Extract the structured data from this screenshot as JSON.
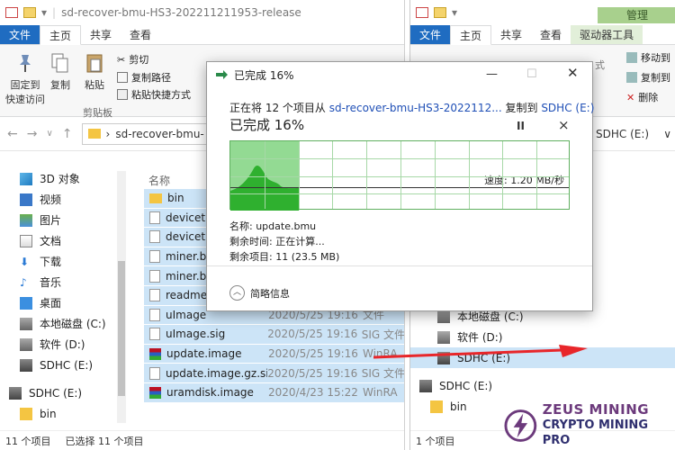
{
  "left_window": {
    "title": "sd-recover-bmu-HS3-202211211953-release",
    "tabs": [
      "文件",
      "主页",
      "共享",
      "查看"
    ],
    "ribbon": {
      "pin": "固定到",
      "pin2": "快速访问",
      "copy": "复制",
      "paste": "粘贴",
      "cut": "剪切",
      "copy_path": "复制路径",
      "paste_shortcut": "粘贴快捷方式",
      "group_clipboard": "剪贴板"
    },
    "address": "sd-recover-bmu-",
    "nav": [
      {
        "label": "3D 对象",
        "icon": "cube-3d-icon"
      },
      {
        "label": "视频",
        "icon": "video-icon"
      },
      {
        "label": "图片",
        "icon": "picture-icon"
      },
      {
        "label": "文档",
        "icon": "document-icon"
      },
      {
        "label": "下载",
        "icon": "download-icon"
      },
      {
        "label": "音乐",
        "icon": "music-icon"
      },
      {
        "label": "桌面",
        "icon": "desktop-icon"
      },
      {
        "label": "本地磁盘 (C:)",
        "icon": "disk-icon"
      },
      {
        "label": "软件 (D:)",
        "icon": "disk-icon"
      },
      {
        "label": "SDHC (E:)",
        "icon": "sd-card-icon"
      },
      {
        "label": "SDHC (E:)",
        "icon": "sd-card-icon"
      },
      {
        "label": "bin",
        "icon": "folder-icon"
      }
    ],
    "column_name": "名称",
    "files": [
      {
        "name": "bin",
        "date": "",
        "type": "",
        "icon": "folder"
      },
      {
        "name": "devicetr",
        "date": "",
        "type": "",
        "icon": "file"
      },
      {
        "name": "devicetr",
        "date": "",
        "type": "",
        "icon": "file"
      },
      {
        "name": "miner.bi",
        "date": "",
        "type": "",
        "icon": "file"
      },
      {
        "name": "miner.bi",
        "date": "",
        "type": "",
        "icon": "file"
      },
      {
        "name": "readme.",
        "date": "",
        "type": "",
        "icon": "file"
      },
      {
        "name": "uImage",
        "date": "2020/5/25 19:16",
        "type": "文件",
        "icon": "file"
      },
      {
        "name": "uImage.sig",
        "date": "2020/5/25 19:16",
        "type": "SIG 文件",
        "icon": "file"
      },
      {
        "name": "update.image",
        "date": "2020/5/25 19:16",
        "type": "WinRA",
        "icon": "rar"
      },
      {
        "name": "update.image.gz.sig",
        "date": "2020/5/25 19:16",
        "type": "SIG 文件",
        "icon": "file"
      },
      {
        "name": "uramdisk.image",
        "date": "2020/4/23 15:22",
        "type": "WinRA",
        "icon": "rar"
      }
    ],
    "status_items": "11 个项目",
    "status_selected": "已选择 11 个项目"
  },
  "right_window": {
    "manage_label": "管理",
    "tabs": [
      "文件",
      "主页",
      "共享",
      "查看",
      "驱动器工具"
    ],
    "ribbon": {
      "move_to": "移动到",
      "copy_to": "复制到",
      "delete": "删除",
      "fmt": "式"
    },
    "address": "SDHC (E:)",
    "nav": [
      {
        "label": "本地磁盘 (C:)",
        "icon": "disk-icon"
      },
      {
        "label": "软件 (D:)",
        "icon": "disk-icon"
      },
      {
        "label": "SDHC (E:)",
        "icon": "sd-card-icon"
      },
      {
        "label": "SDHC (E:)",
        "icon": "sd-card-icon"
      },
      {
        "label": "bin",
        "icon": "folder-icon"
      }
    ],
    "status_items": "1 个项目"
  },
  "dialog": {
    "title": "已完成 16%",
    "line_prefix": "正在将 12 个项目从",
    "source": "sd-recover-bmu-HS3-2022112...",
    "line_mid": "复制到",
    "dest": "SDHC (E:)",
    "percent_label": "已完成 16%",
    "progress_fraction": 0.16,
    "speed": "速度: 1.20 MB/秒",
    "name": "名称: update.bmu",
    "time_left": "剩余时间: 正在计算...",
    "items_left": "剩余项目: 11 (23.5 MB)",
    "details": "简略信息",
    "pause_glyph": "II",
    "close_glyph": "×"
  },
  "logo": {
    "line1": "ZEUS MINING",
    "line2": "CRYPTO MINING PRO"
  },
  "colors": {
    "accent": "#1f6cc1",
    "progress": "#93da93",
    "arrow": "#e8262a",
    "logo_purple": "#6c3a7c"
  }
}
